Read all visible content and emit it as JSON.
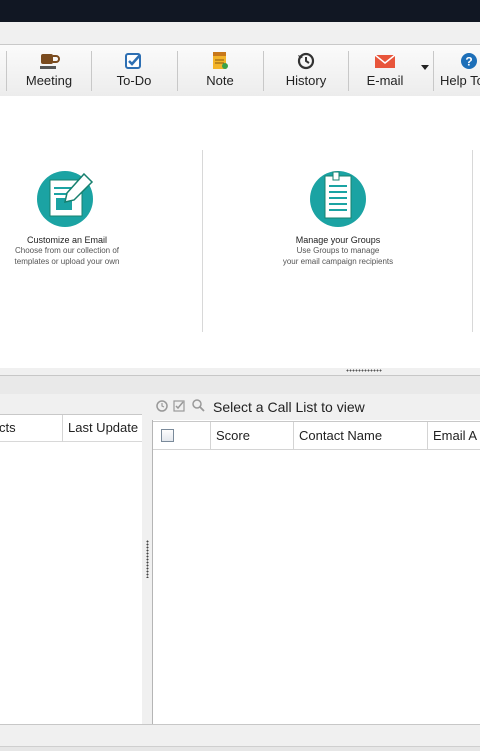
{
  "toolbar": {
    "buttons": [
      {
        "label": "Meeting",
        "icon": "coffee-cup-icon"
      },
      {
        "label": "To-Do",
        "icon": "checkbox-icon"
      },
      {
        "label": "Note",
        "icon": "note-icon"
      },
      {
        "label": "History",
        "icon": "history-clock-icon"
      },
      {
        "label": "E-mail",
        "icon": "envelope-icon"
      },
      {
        "label": "Help To",
        "icon": "help-icon"
      }
    ]
  },
  "promo": {
    "cards": [
      {
        "title": "Customize an Email",
        "line1": "Choose from our collection of",
        "line2": "templates or upload your own"
      },
      {
        "title": "Manage your Groups",
        "line1": "Use Groups to manage",
        "line2": "your email campaign recipients"
      }
    ]
  },
  "left_grid": {
    "columns": [
      "cts",
      "Last Update"
    ]
  },
  "call_list": {
    "header": "Select a Call List to view",
    "columns": [
      "Score",
      "Contact Name",
      "Email A"
    ]
  },
  "colors": {
    "accent_teal": "#1ba3a3",
    "titlebar": "#111723"
  }
}
